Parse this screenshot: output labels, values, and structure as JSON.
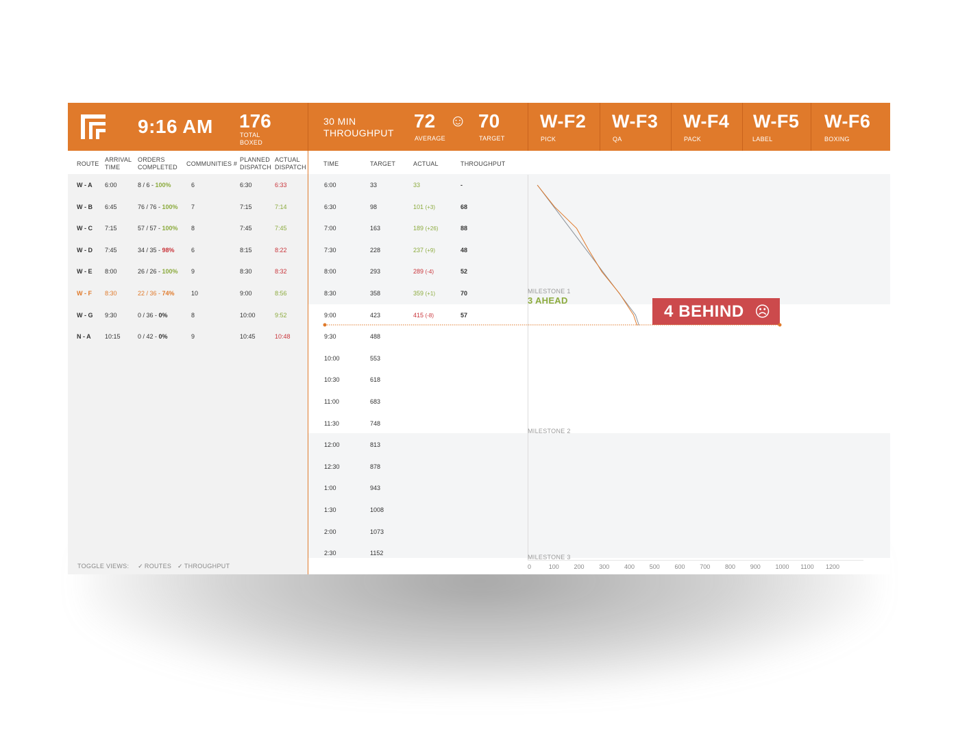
{
  "header": {
    "clock": "9:16 AM",
    "total_boxed": "176",
    "total_boxed_label_1": "TOTAL",
    "total_boxed_label_2": "BOXED",
    "throughput_label_1": "30 MIN",
    "throughput_label_2": "THROUGHPUT",
    "average": "72",
    "average_label": "AVERAGE",
    "mood_icon": "smiley-face-icon",
    "mood_glyph": "☺",
    "target": "70",
    "target_label": "TARGET",
    "stations": [
      {
        "name": "W-F2",
        "label": "PICK"
      },
      {
        "name": "W-F3",
        "label": "QA"
      },
      {
        "name": "W-F4",
        "label": "PACK"
      },
      {
        "name": "W-F5",
        "label": "LABEL"
      },
      {
        "name": "W-F6",
        "label": "BOXING"
      }
    ]
  },
  "routes": {
    "headers": {
      "route": "ROUTE",
      "arrival_1": "ARRIVAL",
      "arrival_2": "TIME",
      "orders_1": "ORDERS",
      "orders_2": "COMPLETED",
      "communities": "COMMUNITIES #",
      "planned_1": "PLANNED",
      "planned_2": "DISPATCH",
      "actual_1": "ACTUAL",
      "actual_2": "DISPATCH"
    },
    "rows": [
      {
        "route": "W - A",
        "arrival": "6:00",
        "orders": "8 / 6 - ",
        "pct": "100%",
        "communities": "6",
        "planned": "6:30",
        "actual": "6:33",
        "pct_color": "green",
        "actual_color": "red",
        "row_color": "dark"
      },
      {
        "route": "W - B",
        "arrival": "6:45",
        "orders": "76 / 76 - ",
        "pct": "100%",
        "communities": "7",
        "planned": "7:15",
        "actual": "7:14",
        "pct_color": "green",
        "actual_color": "green",
        "row_color": "dark"
      },
      {
        "route": "W - C",
        "arrival": "7:15",
        "orders": "57 / 57 - ",
        "pct": "100%",
        "communities": "8",
        "planned": "7:45",
        "actual": "7:45",
        "pct_color": "green",
        "actual_color": "green",
        "row_color": "dark"
      },
      {
        "route": "W - D",
        "arrival": "7:45",
        "orders": "34 / 35 - ",
        "pct": "98%",
        "communities": "6",
        "planned": "8:15",
        "actual": "8:22",
        "pct_color": "red",
        "actual_color": "red",
        "row_color": "dark"
      },
      {
        "route": "W - E",
        "arrival": "8:00",
        "orders": "26 / 26 - ",
        "pct": "100%",
        "communities": "9",
        "planned": "8:30",
        "actual": "8:32",
        "pct_color": "green",
        "actual_color": "red",
        "row_color": "dark"
      },
      {
        "route": "W - F",
        "arrival": "8:30",
        "orders": "22 / 36 - ",
        "pct": "74%",
        "communities": "10",
        "planned": "9:00",
        "actual": "8:56",
        "pct_color": "orange",
        "actual_color": "green",
        "row_color": "orange"
      },
      {
        "route": "W - G",
        "arrival": "9:30",
        "orders": "0 / 36 - ",
        "pct": "0%",
        "communities": "8",
        "planned": "10:00",
        "actual": "9:52",
        "pct_color": "dark",
        "actual_color": "green",
        "row_color": "dark"
      },
      {
        "route": "N - A",
        "arrival": "10:15",
        "orders": "0 / 42 - ",
        "pct": "0%",
        "communities": "9",
        "planned": "10:45",
        "actual": "10:48",
        "pct_color": "dark",
        "actual_color": "red",
        "row_color": "dark"
      }
    ],
    "toggle_label": "TOGGLE VIEWS:",
    "toggle_routes": "ROUTES",
    "toggle_throughput": "THROUGHPUT"
  },
  "throughput": {
    "headers": {
      "time": "TIME",
      "target": "TARGET",
      "actual": "ACTUAL",
      "throughput": "THROUGHPUT"
    },
    "rows": [
      {
        "time": "6:00",
        "target": "33",
        "actual": "33",
        "delta": "",
        "throughput": "-",
        "color": "green"
      },
      {
        "time": "6:30",
        "target": "98",
        "actual": "101",
        "delta": "(+3)",
        "throughput": "68",
        "color": "green"
      },
      {
        "time": "7:00",
        "target": "163",
        "actual": "189",
        "delta": "(+26)",
        "throughput": "88",
        "color": "green"
      },
      {
        "time": "7:30",
        "target": "228",
        "actual": "237",
        "delta": "(+9)",
        "throughput": "48",
        "color": "green"
      },
      {
        "time": "8:00",
        "target": "293",
        "actual": "289",
        "delta": "(-4)",
        "throughput": "52",
        "color": "red"
      },
      {
        "time": "8:30",
        "target": "358",
        "actual": "359",
        "delta": "(+1)",
        "throughput": "70",
        "color": "green"
      },
      {
        "time": "9:00",
        "target": "423",
        "actual": "415",
        "delta": "(-8)",
        "throughput": "57",
        "color": "red"
      },
      {
        "time": "9:30",
        "target": "488",
        "actual": "",
        "delta": "",
        "throughput": "",
        "color": "dark"
      },
      {
        "time": "10:00",
        "target": "553",
        "actual": "",
        "delta": "",
        "throughput": "",
        "color": "dark"
      },
      {
        "time": "10:30",
        "target": "618",
        "actual": "",
        "delta": "",
        "throughput": "",
        "color": "dark"
      },
      {
        "time": "11:00",
        "target": "683",
        "actual": "",
        "delta": "",
        "throughput": "",
        "color": "dark"
      },
      {
        "time": "11:30",
        "target": "748",
        "actual": "",
        "delta": "",
        "throughput": "",
        "color": "dark"
      },
      {
        "time": "12:00",
        "target": "813",
        "actual": "",
        "delta": "",
        "throughput": "",
        "color": "dark"
      },
      {
        "time": "12:30",
        "target": "878",
        "actual": "",
        "delta": "",
        "throughput": "",
        "color": "dark"
      },
      {
        "time": "1:00",
        "target": "943",
        "actual": "",
        "delta": "",
        "throughput": "",
        "color": "dark"
      },
      {
        "time": "1:30",
        "target": "1008",
        "actual": "",
        "delta": "",
        "throughput": "",
        "color": "dark"
      },
      {
        "time": "2:00",
        "target": "1073",
        "actual": "",
        "delta": "",
        "throughput": "",
        "color": "dark"
      },
      {
        "time": "2:30",
        "target": "1152",
        "actual": "",
        "delta": "",
        "throughput": "",
        "color": "dark"
      }
    ]
  },
  "graph": {
    "milestone_1": "MILESTONE 1",
    "milestone_2": "MILESTONE 2",
    "milestone_3": "MILESTONE 3",
    "ahead_text": "3 AHEAD",
    "behind_text": "4 BEHIND",
    "behind_icon": "frown-face-icon",
    "behind_glyph": "☹",
    "x_ticks": [
      "0",
      "100",
      "200",
      "300",
      "400",
      "500",
      "600",
      "700",
      "800",
      "900",
      "1000",
      "1100",
      "1200"
    ]
  },
  "chart_data": {
    "type": "line",
    "x_axis_range": [
      0,
      1200
    ],
    "categories": [
      "6:00",
      "6:30",
      "7:00",
      "7:30",
      "8:00",
      "8:30",
      "9:00"
    ],
    "series": [
      {
        "values": [
          33,
          98,
          163,
          228,
          293,
          358,
          423
        ]
      },
      {
        "values": [
          33,
          101,
          189,
          237,
          289,
          359,
          415
        ]
      }
    ]
  },
  "colors": {
    "accent": "#e07a2b",
    "green": "#8cab3e",
    "red": "#c9353b",
    "alert_bg": "#cc4a4c"
  }
}
